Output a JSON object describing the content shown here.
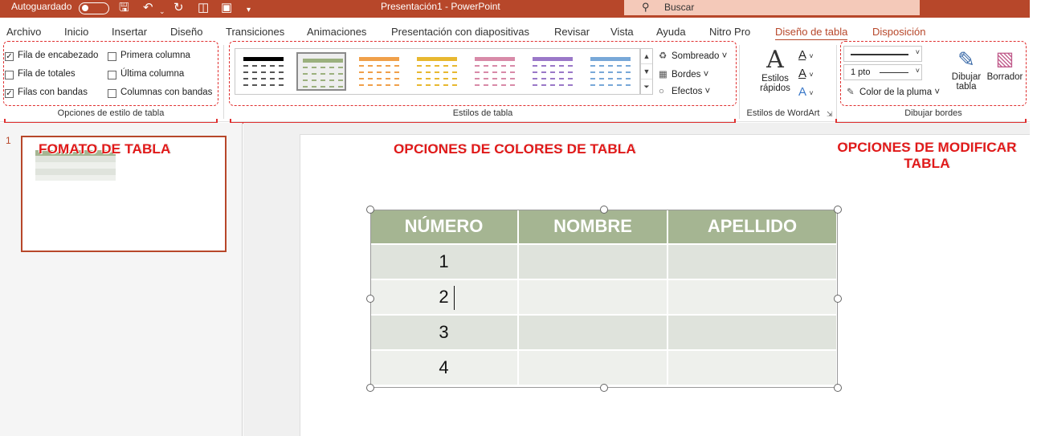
{
  "titlebar": {
    "autosave_label": "Autoguardado",
    "doc_title": "Presentación1  -  PowerPoint",
    "search_placeholder": "Buscar"
  },
  "tabs": [
    "Archivo",
    "Inicio",
    "Insertar",
    "Diseño",
    "Transiciones",
    "Animaciones",
    "Presentación con diapositivas",
    "Revisar",
    "Vista",
    "Ayuda",
    "Nitro Pro",
    "Diseño de tabla",
    "Disposición"
  ],
  "active_tab": "Diseño de tabla",
  "ribbon": {
    "opciones_estilo": {
      "group_label": "Opciones de estilo de tabla",
      "checkboxes": [
        {
          "label": "Fila de encabezado",
          "checked": true
        },
        {
          "label": "Fila de totales",
          "checked": false
        },
        {
          "label": "Filas con bandas",
          "checked": true
        },
        {
          "label": "Primera columna",
          "checked": false
        },
        {
          "label": "Última columna",
          "checked": false
        },
        {
          "label": "Columnas con bandas",
          "checked": false
        }
      ]
    },
    "estilos_tabla": {
      "group_label": "Estilos de tabla",
      "style_colors": [
        "#000000",
        "#9bb07e",
        "#f0a04a",
        "#e8b830",
        "#d88aa8",
        "#9a78c8",
        "#78a8d8"
      ],
      "shading_label": "Sombreado",
      "borders_label": "Bordes",
      "effects_label": "Efectos"
    },
    "wordart": {
      "group_label": "Estilos de WordArt",
      "quick_styles_line1": "Estilos",
      "quick_styles_line2": "rápidos"
    },
    "dibujar_bordes": {
      "group_label": "Dibujar bordes",
      "pen_weight": "1 pto",
      "pen_color_label": "Color de la pluma",
      "draw_table_line1": "Dibujar",
      "draw_table_line2": "tabla",
      "eraser_label": "Borrador"
    }
  },
  "annotations": {
    "left": "FOMATO DE TABLA",
    "center": "OPCIONES DE COLORES DE TABLA",
    "right_line1": "OPCIONES DE MODIFICAR",
    "right_line2": "TABLA"
  },
  "slides": {
    "number": "1"
  },
  "table": {
    "headers": [
      "NÚMERO",
      "NOMBRE",
      "APELLIDO"
    ],
    "rows": [
      [
        "1",
        "",
        ""
      ],
      [
        "2",
        "",
        ""
      ],
      [
        "3",
        "",
        ""
      ],
      [
        "4",
        "",
        ""
      ]
    ],
    "header_color": "#a5b592"
  }
}
